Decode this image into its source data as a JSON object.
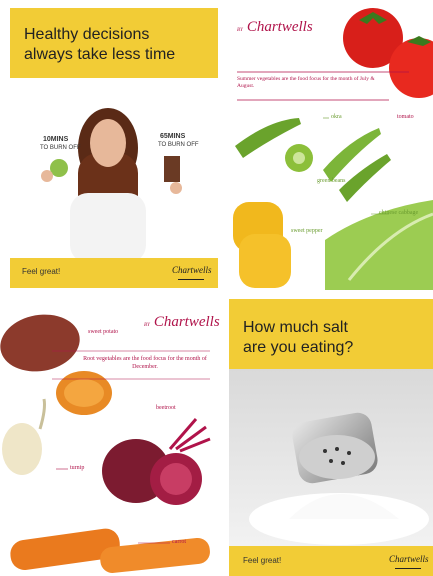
{
  "panel1": {
    "headline_line1": "Healthy decisions",
    "headline_line2": "always take less time",
    "left_mins": "10MINS",
    "left_text": "TO BURN OFF",
    "right_mins": "65MINS",
    "right_text": "TO BURN OFF",
    "footer": "Feel great!",
    "brand": "Chartwells"
  },
  "panel2": {
    "brand_prefix": "BY",
    "brand": "Chartwells",
    "intro": "Summer vegetables are the food focus for the month of July & August.",
    "labels": {
      "tomato": "tomato",
      "okra": "okra",
      "green_beans": "green beans",
      "sweet_pepper": "sweet pepper",
      "chinese_cabbage": "chinese cabbage"
    }
  },
  "panel3": {
    "brand_prefix": "BY",
    "brand": "Chartwells",
    "intro": "Root vegetables are the food focus for the month of December.",
    "labels": {
      "sweet_potato": "sweet potato",
      "beetroot": "beetroot",
      "turnip": "turnip",
      "carrot": "carrot"
    }
  },
  "panel4": {
    "headline_line1": "How much salt",
    "headline_line2": "are you eating?",
    "footer": "Feel great!",
    "brand": "Chartwells"
  },
  "colors": {
    "yellow": "#f2cc36",
    "brand_pink": "#b0134a",
    "label_green": "#6a9c2f"
  }
}
